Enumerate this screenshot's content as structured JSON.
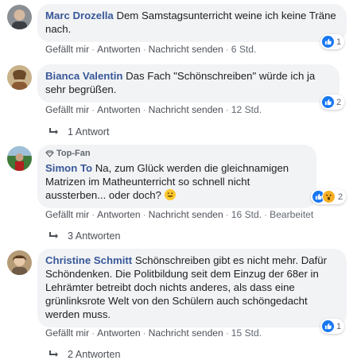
{
  "colors": {
    "author": "#385898",
    "bubble": "#f2f3f5",
    "like": "#1877f2",
    "meta": "#606770"
  },
  "comments": [
    {
      "author": "Marc Drozella",
      "text": "Dem Samstagsunterricht weine ich keine Träne nach.",
      "actions": [
        "Gefällt mir",
        "Antworten",
        "Nachricht senden"
      ],
      "time": "6 Std.",
      "reaction_count": "1",
      "reaction_icons": [
        "like-icon"
      ]
    },
    {
      "author": "Bianca Valentin",
      "text": "Das Fach \"Schönschreiben\" würde ich ja sehr begrüßen.",
      "actions": [
        "Gefällt mir",
        "Antworten",
        "Nachricht senden"
      ],
      "time": "12 Std.",
      "reaction_count": "2",
      "reaction_icons": [
        "like-icon"
      ],
      "replies_label": "1 Antwort"
    },
    {
      "badge": "Top-Fan",
      "author": "Simon To",
      "text": "Na, zum Glück werden die gleichnamigen Matrizen im Matheunterricht so schnell nicht aussterben... oder doch?",
      "actions": [
        "Gefällt mir",
        "Antworten",
        "Nachricht senden"
      ],
      "time": "16 Std.",
      "edited": "Bearbeitet",
      "reaction_count": "2",
      "reaction_icons": [
        "like-icon",
        "wow-icon"
      ],
      "replies_label": "3 Antworten"
    },
    {
      "author": "Christine Schmitt",
      "text": "Schönschreiben gibt es nicht mehr. Dafür Schöndenken. Die Politbildung seit dem Einzug der 68er in Lehrämter betreibt doch nichts anderes, als dass eine grünlinksrote Welt von den Schülern auch schöngedacht werden muss.",
      "actions": [
        "Gefällt mir",
        "Antworten",
        "Nachricht senden"
      ],
      "time": "15 Std.",
      "reaction_count": "1",
      "reaction_icons": [
        "like-icon"
      ],
      "replies_label": "2 Antworten"
    }
  ]
}
